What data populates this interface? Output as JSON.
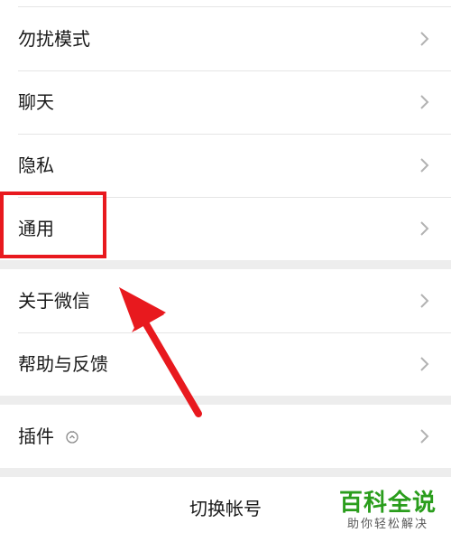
{
  "settings": {
    "items": [
      {
        "label": "勿扰模式",
        "chevron_icon": "chevron-right-icon"
      },
      {
        "label": "聊天",
        "chevron_icon": "chevron-right-icon"
      },
      {
        "label": "隐私",
        "chevron_icon": "chevron-right-icon"
      },
      {
        "label": "通用",
        "chevron_icon": "chevron-right-icon"
      },
      {
        "label": "关于微信",
        "chevron_icon": "chevron-right-icon"
      },
      {
        "label": "帮助与反馈",
        "chevron_icon": "chevron-right-icon"
      },
      {
        "label": "插件",
        "icon": "plugin-sprout-icon",
        "chevron_icon": "chevron-right-icon"
      }
    ],
    "switch_account_label": "切换帐号"
  },
  "annotation": {
    "highlight_color": "#e8191e",
    "arrow_color": "#e8191e",
    "highlighted_item": "通用"
  },
  "watermark": {
    "main": "百科全说",
    "sub": "助你轻松解决",
    "main_color": "#2a9d1c"
  }
}
